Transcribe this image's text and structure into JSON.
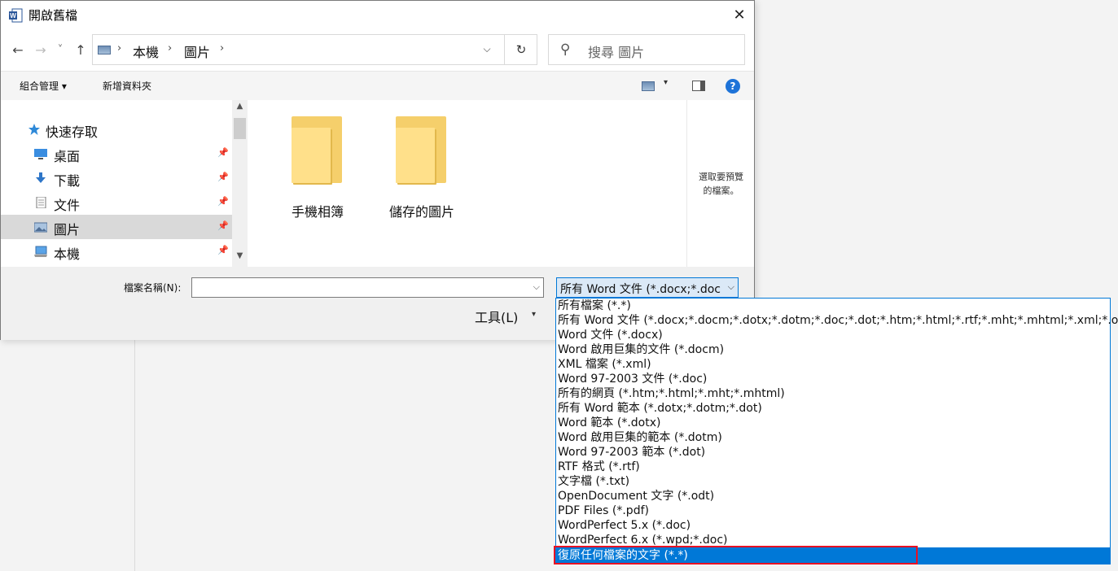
{
  "window": {
    "title": "開啟舊檔",
    "close": "✕"
  },
  "nav": {
    "back": "←",
    "forward": "→",
    "recent": "˅",
    "up": "↑"
  },
  "address": {
    "sep": "›",
    "crumbs": [
      "本機",
      "圖片"
    ],
    "dropdown": "⌵",
    "refresh": "↻"
  },
  "search": {
    "icon": "⚲",
    "placeholder": "搜尋 圖片"
  },
  "toolbar": {
    "organize": "組合管理 ▾",
    "new_folder": "新增資料夾",
    "view_dropdown": "▾",
    "help": "?"
  },
  "sidebar": {
    "items": [
      {
        "label": "快速存取",
        "icon": "star-icon"
      },
      {
        "label": "桌面",
        "icon": "desktop-icon"
      },
      {
        "label": "下載",
        "icon": "download-icon"
      },
      {
        "label": "文件",
        "icon": "document-icon"
      },
      {
        "label": "圖片",
        "icon": "pictures-icon"
      },
      {
        "label": "本機",
        "icon": "computer-icon"
      }
    ],
    "pin": "📌",
    "scroll_up": "▲",
    "scroll_down": "▼"
  },
  "files": [
    {
      "label": "手機相簿"
    },
    {
      "label": "儲存的圖片"
    }
  ],
  "preview": {
    "line1": "選取要預覽",
    "line2": "的檔案。"
  },
  "bottom": {
    "filename_label": "檔案名稱(N):",
    "filename_value": "",
    "filename_dropdown": "⌵",
    "filetype_value": "所有 Word 文件 (*.docx;*.docm",
    "filetype_dropdown": "⌵",
    "tools_label": "工具(L)",
    "tools_dropdown": "▾"
  },
  "filetype_options": [
    "所有檔案 (*.*)",
    "所有 Word 文件 (*.docx;*.docm;*.dotx;*.dotm;*.doc;*.dot;*.htm;*.html;*.rtf;*.mht;*.mhtml;*.xml;*.odt;*.pdf)",
    "Word 文件 (*.docx)",
    "Word 啟用巨集的文件 (*.docm)",
    "XML 檔案 (*.xml)",
    "Word 97-2003 文件 (*.doc)",
    "所有的網頁 (*.htm;*.html;*.mht;*.mhtml)",
    "所有 Word 範本 (*.dotx;*.dotm;*.dot)",
    "Word 範本 (*.dotx)",
    "Word 啟用巨集的範本 (*.dotm)",
    "Word 97-2003 範本 (*.dot)",
    "RTF 格式 (*.rtf)",
    "文字檔  (*.txt)",
    "OpenDocument 文字 (*.odt)",
    "PDF Files (*.pdf)",
    "WordPerfect 5.x (*.doc)",
    "WordPerfect 6.x (*.wpd;*.doc)",
    "復原任何檔案的文字 (*.*)"
  ],
  "highlighted_option": 17,
  "colors": {
    "accent": "#0078d7",
    "annotation_red": "#e81123",
    "folder_yellow": "#ffe08a"
  }
}
